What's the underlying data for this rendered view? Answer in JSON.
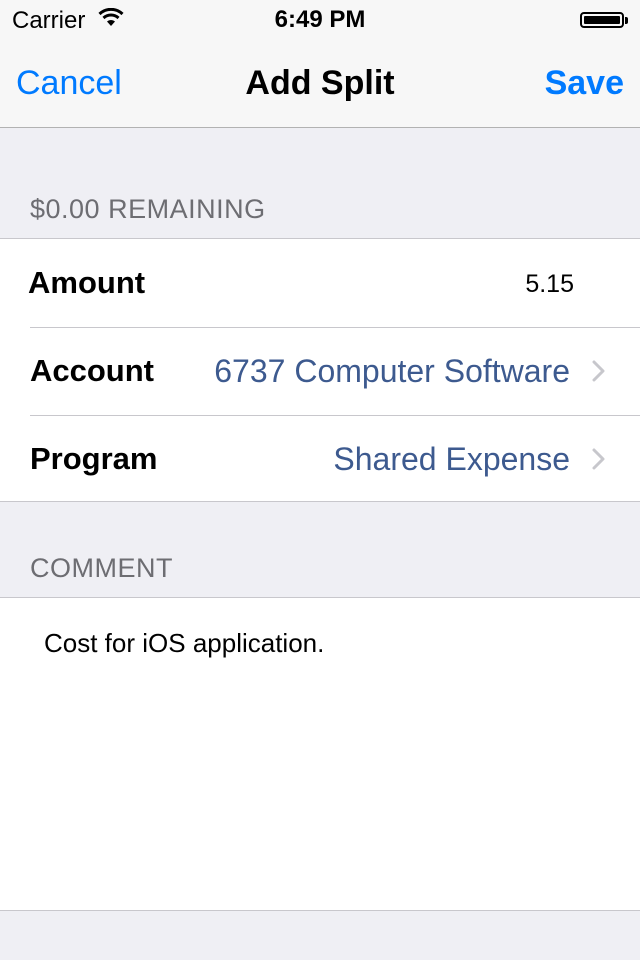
{
  "status_bar": {
    "carrier": "Carrier",
    "time": "6:49 PM",
    "wifi_icon": "wifi-icon",
    "battery_icon": "battery-icon"
  },
  "nav": {
    "cancel_label": "Cancel",
    "title": "Add Split",
    "save_label": "Save",
    "accent_color": "#007aff"
  },
  "split_section": {
    "header": "$0.00 REMAINING",
    "rows": [
      {
        "label": "Amount",
        "value": "5.15"
      },
      {
        "label": "Account",
        "value": "6737 Computer Software",
        "chevron_icon": "chevron-right-icon"
      },
      {
        "label": "Program",
        "value": "Shared Expense",
        "chevron_icon": "chevron-right-icon"
      }
    ]
  },
  "comment_section": {
    "header": "COMMENT",
    "text": "Cost for iOS application."
  },
  "colors": {
    "background": "#efeff4",
    "detail_value": "#3d5a8f",
    "section_header": "#6d6d72"
  }
}
